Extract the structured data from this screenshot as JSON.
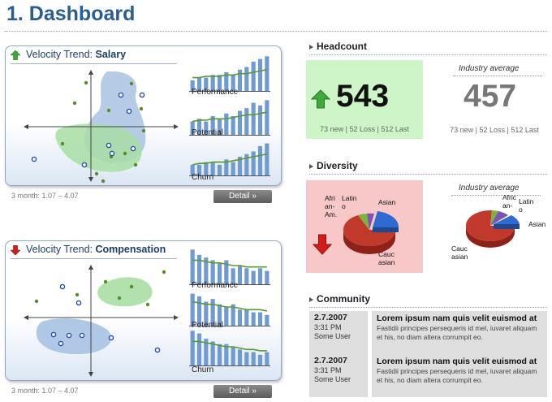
{
  "page": {
    "title": "1. Dashboard"
  },
  "velocity": [
    {
      "trend": "up",
      "prefix": "Velocity Trend:",
      "name": "Salary",
      "sparklines": [
        {
          "label": "Performance",
          "bars": [
            4,
            5,
            5,
            6,
            6,
            7,
            6,
            8,
            9,
            11,
            12,
            13
          ],
          "line": [
            5,
            5,
            5.5,
            5.5,
            5.5,
            6,
            6,
            6.5,
            6.5,
            7,
            7.5,
            8
          ]
        },
        {
          "label": "Potential",
          "bars": [
            5,
            6,
            5,
            7,
            6,
            8,
            7,
            9,
            10,
            12,
            11,
            13
          ],
          "line": [
            5,
            5.5,
            5.5,
            6,
            6,
            6,
            6.5,
            7,
            7.5,
            7.5,
            8,
            8.5
          ]
        },
        {
          "label": "Churn",
          "bars": [
            4,
            4,
            5,
            5,
            4,
            6,
            5,
            7,
            8,
            9,
            11,
            12
          ],
          "line": [
            4,
            4.5,
            4.5,
            5,
            5,
            5,
            5.5,
            6,
            6.5,
            7,
            7.5,
            8
          ]
        }
      ],
      "range": "3 month: 1.07 – 4.07",
      "detail": "Detail »"
    },
    {
      "trend": "down",
      "prefix": "Velocity Trend:",
      "name": "Compensation",
      "sparklines": [
        {
          "label": "Performance",
          "bars": [
            13,
            11,
            10,
            9,
            8,
            9,
            6,
            7,
            6,
            5,
            6,
            5
          ],
          "line": [
            9,
            9,
            8.5,
            8,
            8,
            7.5,
            7,
            7,
            6.5,
            6.5,
            6.5,
            6.5
          ]
        },
        {
          "label": "Potential",
          "bars": [
            12,
            11,
            9,
            10,
            8,
            7,
            8,
            6,
            6,
            5,
            5,
            4
          ],
          "line": [
            9,
            8.5,
            8,
            8,
            7.5,
            7,
            7,
            6.5,
            6,
            6,
            6,
            5.5
          ]
        },
        {
          "label": "Churn",
          "bars": [
            13,
            12,
            10,
            9,
            8,
            8,
            7,
            6,
            5,
            5,
            4,
            5
          ],
          "line": [
            9,
            9,
            8.5,
            8,
            7.5,
            7,
            7,
            6.5,
            6,
            6,
            5.5,
            5.5
          ]
        }
      ],
      "range": "3 month: 1.07 – 4.07",
      "detail": "Detail »"
    }
  ],
  "headcount": {
    "heading": "Headcount",
    "value": "543",
    "sub": "73 new | 52 Loss | 512 Last",
    "industry_label": "Industry average",
    "industry_value": "457",
    "industry_sub": "73 new | 52 Loss | 512 Last"
  },
  "diversity": {
    "heading": "Diversity",
    "trend": "down",
    "industry_label": "Industry average",
    "labels_left": {
      "african": "Afri an- Am.",
      "latino": "Latin o",
      "asian": "Asian",
      "caucasian": "Cauc asian"
    },
    "labels_right": {
      "african": "Afric an-",
      "latino": "Latin o",
      "asian": "Asian",
      "caucasian": "Cauc asian"
    }
  },
  "community": {
    "heading": "Community",
    "items": [
      {
        "date": "2.7.2007",
        "time": "3:31 PM",
        "user": "Some User",
        "title": "Lorem ipsum nam quis velit euismod at",
        "body": "Fastidii principes persequeris id mel, iuvaret aliquam et his, no diam altera corrumpit eo."
      },
      {
        "date": "2.7.2007",
        "time": "3:31 PM",
        "user": "Some User",
        "title": "Lorem ipsum nam quis velit euismod at",
        "body": "Fastidii principes persequeris id mel, iuvaret aliquam et his, no diam altera corrumpit eo."
      }
    ]
  },
  "colors": {
    "title": "#2a5d94",
    "up_green": "#3fa83a",
    "down_red": "#d21c1c",
    "headcount_bg": "#cdf5c8",
    "diversity_bg": "#f8c7c7",
    "bar": "#6f9bd0",
    "trend_line": "#5a9a2c",
    "pie_caucasian": "#c0392b",
    "pie_asian": "#2f6ad0",
    "pie_latino": "#7b55b0",
    "pie_african": "#7ab43a"
  }
}
